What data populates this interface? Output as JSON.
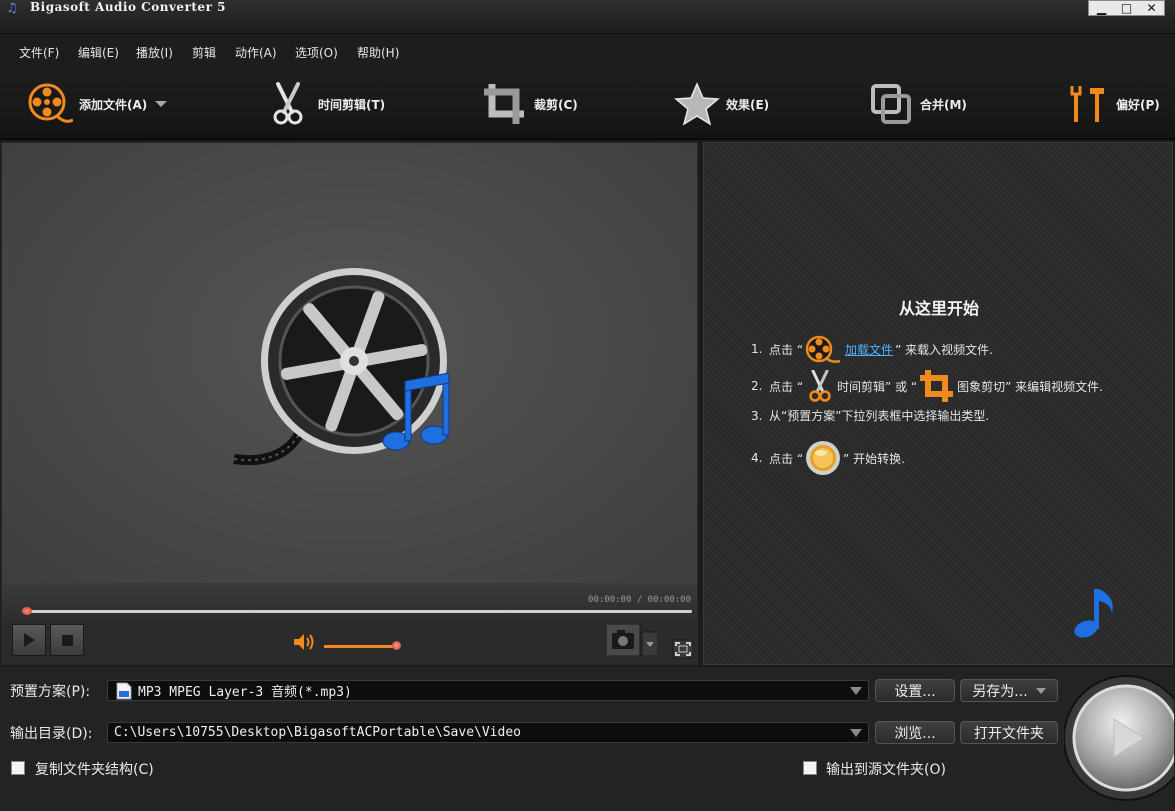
{
  "window": {
    "title": "Bigasoft Audio Converter 5",
    "minimize": "▁",
    "maximize": "□",
    "close": "✕"
  },
  "menu": [
    "文件(F)",
    "编辑(E)",
    "播放(I)",
    "剪辑",
    "动作(A)",
    "选项(O)",
    "帮助(H)"
  ],
  "toolbar": {
    "add_file": "添加文件(A)",
    "trim": "时间剪辑(T)",
    "crop": "裁剪(C)",
    "effect": "效果(E)",
    "merge": "合并(M)",
    "preferences": "偏好(P)"
  },
  "preview": {
    "timecode": "00:00:00 / 00:00:00",
    "progress": 0,
    "volume": 1.0
  },
  "guide": {
    "title": "从这里开始",
    "step1": {
      "num": "1.",
      "pre": "点击 “",
      "link": " 加载文件 ",
      "post": "” 来载入视频文件."
    },
    "step2": {
      "num": "2.",
      "pre": "点击 “",
      "mid": " 时间剪辑” 或 “",
      "post": " 图象剪切” 来编辑视频文件."
    },
    "step3": {
      "num": "3.",
      "text": "从“预置方案”下拉列表框中选择输出类型."
    },
    "step4": {
      "num": "4.",
      "pre": "点击 “",
      "post": "” 开始转换."
    }
  },
  "bottom": {
    "preset_label": "预置方案(P):",
    "preset_value": "MP3 MPEG Layer-3 音频(*.mp3)",
    "output_label": "输出目录(D):",
    "output_value": "C:\\Users\\10755\\Desktop\\BigasoftACPortable\\Save\\Video",
    "settings_button": "设置...",
    "save_as_button": "另存为...",
    "browse_button": "浏览...",
    "open_folder_button": "打开文件夹",
    "copy_structure_label": "复制文件夹结构(C)",
    "copy_structure_checked": false,
    "output_to_source_label": "输出到源文件夹(O)",
    "output_to_source_checked": false
  },
  "colors": {
    "accent_orange": "#f08a1e",
    "link_blue": "#4fb3ff",
    "note_blue": "#1f6fe0"
  }
}
